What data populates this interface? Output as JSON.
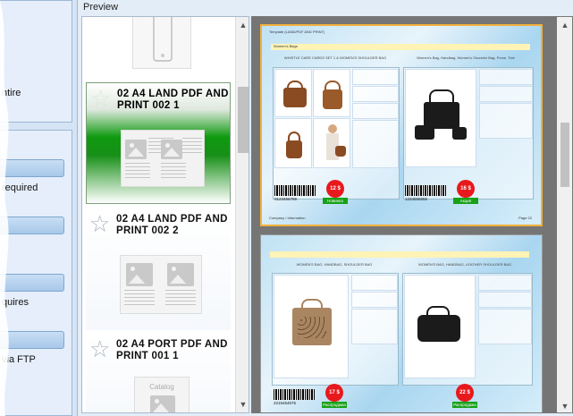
{
  "sidebar": {
    "panel1_label": "ntire",
    "panel2_labels": [
      " required",
      "quires",
      "via FTP"
    ]
  },
  "preview": {
    "title": "Preview",
    "templates": [
      {
        "title_line1": "02 A4 LAND PDF AND",
        "title_line2": "PRINT 002 1",
        "selected": true
      },
      {
        "title_line1": "02 A4 LAND PDF AND",
        "title_line2": "PRINT 002 2",
        "selected": false
      },
      {
        "title_line1": "02 A4 PORT PDF AND",
        "title_line2": "PRINT 001 1",
        "selected": false
      }
    ],
    "third_tile_label": "Catalog",
    "scroll_up": "▲",
    "scroll_down": "▼"
  },
  "pages": [
    {
      "header": "Template (LAND/PDF AND PRINT)",
      "category": "Women's Bags",
      "desc_left": "WHISTLE CARE CARDS SET 1 & WOMEN'S SHOULDER BAG",
      "desc_right": "Women's Bag, Handbag, Women's Shoulder Bag, Purse, Tote",
      "price_left": "12 $",
      "price_right": "16 $",
      "tag_left": "Новинка",
      "tag_right": "Акция",
      "barcode_left": "0123456789",
      "barcode_right": "1234555555",
      "footer_left": "Company / Information",
      "footer_right": "Page 22"
    },
    {
      "desc_left": "WOMEN'S BAG, HANDBAG, SHOULDER BAG",
      "desc_right": "WOMEN'S BAG, HANDBAG, LEATHER SHOULDER BAG",
      "price_left": "17 $",
      "price_right": "22 $",
      "tag_left": "Распродажа",
      "tag_right": "Распродажа",
      "barcode_left": "2215454575"
    }
  ],
  "colors": {
    "selected_green": "#0f9a0f",
    "highlight_border": "#f2b13b",
    "price_red": "#e8191c"
  }
}
